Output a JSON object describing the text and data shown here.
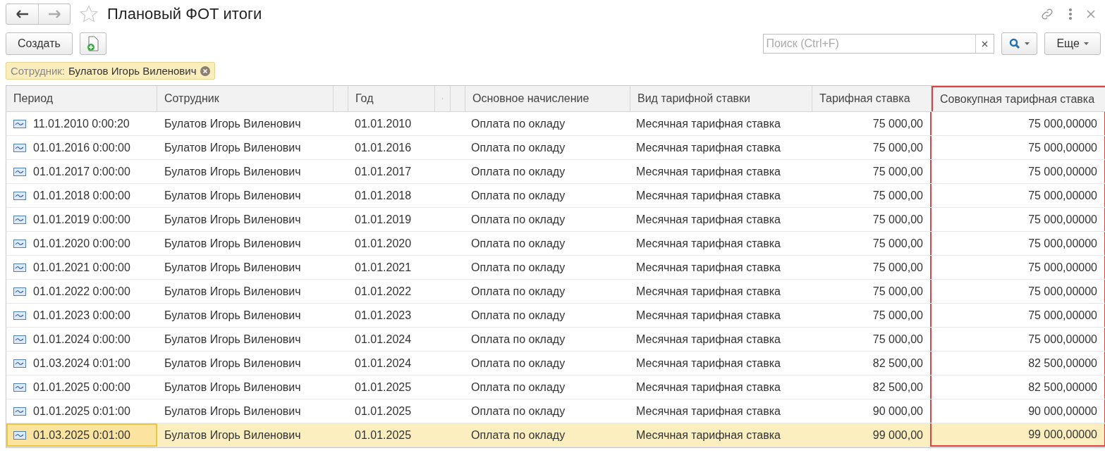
{
  "window": {
    "title": "Плановый ФОТ итоги",
    "favorite": false
  },
  "toolbar": {
    "create_label": "Создать",
    "search": {
      "placeholder": "Поиск (Ctrl+F)"
    },
    "more_label": "Еще"
  },
  "filter": {
    "label": "Сотрудник:",
    "value": "Булатов Игорь Виленович"
  },
  "table": {
    "columns": [
      {
        "label": "Период",
        "kind": "text",
        "highlighted": false
      },
      {
        "label": "Сотрудник",
        "kind": "text",
        "highlighted": false
      },
      {
        "kind": "spacer",
        "highlighted": false
      },
      {
        "label": "Год",
        "kind": "text",
        "highlighted": false
      },
      {
        "kind": "sort",
        "highlighted": false
      },
      {
        "kind": "spacer",
        "highlighted": false
      },
      {
        "label": "Основное начисление",
        "kind": "text",
        "highlighted": false
      },
      {
        "label": "Вид тарифной ставки",
        "kind": "text",
        "highlighted": false
      },
      {
        "label": "Тарифная ставка",
        "kind": "number",
        "highlighted": false
      },
      {
        "label": "Совокупная тарифная ставка",
        "kind": "number",
        "highlighted": true
      }
    ],
    "rows": [
      {
        "selected": false,
        "cells": [
          "11.01.2010 0:00:20",
          "Булатов Игорь Виленович",
          null,
          "01.01.2010",
          null,
          null,
          "Оплата по окладу",
          "Месячная тарифная ставка",
          "75 000,00",
          "75 000,00000"
        ]
      },
      {
        "selected": false,
        "cells": [
          "01.01.2016 0:00:00",
          "Булатов Игорь Виленович",
          null,
          "01.01.2016",
          null,
          null,
          "Оплата по окладу",
          "Месячная тарифная ставка",
          "75 000,00",
          "75 000,00000"
        ]
      },
      {
        "selected": false,
        "cells": [
          "01.01.2017 0:00:00",
          "Булатов Игорь Виленович",
          null,
          "01.01.2017",
          null,
          null,
          "Оплата по окладу",
          "Месячная тарифная ставка",
          "75 000,00",
          "75 000,00000"
        ]
      },
      {
        "selected": false,
        "cells": [
          "01.01.2018 0:00:00",
          "Булатов Игорь Виленович",
          null,
          "01.01.2018",
          null,
          null,
          "Оплата по окладу",
          "Месячная тарифная ставка",
          "75 000,00",
          "75 000,00000"
        ]
      },
      {
        "selected": false,
        "cells": [
          "01.01.2019 0:00:00",
          "Булатов Игорь Виленович",
          null,
          "01.01.2019",
          null,
          null,
          "Оплата по окладу",
          "Месячная тарифная ставка",
          "75 000,00",
          "75 000,00000"
        ]
      },
      {
        "selected": false,
        "cells": [
          "01.01.2020 0:00:00",
          "Булатов Игорь Виленович",
          null,
          "01.01.2020",
          null,
          null,
          "Оплата по окладу",
          "Месячная тарифная ставка",
          "75 000,00",
          "75 000,00000"
        ]
      },
      {
        "selected": false,
        "cells": [
          "01.01.2021 0:00:00",
          "Булатов Игорь Виленович",
          null,
          "01.01.2021",
          null,
          null,
          "Оплата по окладу",
          "Месячная тарифная ставка",
          "75 000,00",
          "75 000,00000"
        ]
      },
      {
        "selected": false,
        "cells": [
          "01.01.2022 0:00:00",
          "Булатов Игорь Виленович",
          null,
          "01.01.2022",
          null,
          null,
          "Оплата по окладу",
          "Месячная тарифная ставка",
          "75 000,00",
          "75 000,00000"
        ]
      },
      {
        "selected": false,
        "cells": [
          "01.01.2023 0:00:00",
          "Булатов Игорь Виленович",
          null,
          "01.01.2023",
          null,
          null,
          "Оплата по окладу",
          "Месячная тарифная ставка",
          "75 000,00",
          "75 000,00000"
        ]
      },
      {
        "selected": false,
        "cells": [
          "01.01.2024 0:00:00",
          "Булатов Игорь Виленович",
          null,
          "01.01.2024",
          null,
          null,
          "Оплата по окладу",
          "Месячная тарифная ставка",
          "75 000,00",
          "75 000,00000"
        ]
      },
      {
        "selected": false,
        "cells": [
          "01.03.2024 0:01:00",
          "Булатов Игорь Виленович",
          null,
          "01.01.2024",
          null,
          null,
          "Оплата по окладу",
          "Месячная тарифная ставка",
          "82 500,00",
          "82 500,00000"
        ]
      },
      {
        "selected": false,
        "cells": [
          "01.01.2025 0:00:00",
          "Булатов Игорь Виленович",
          null,
          "01.01.2025",
          null,
          null,
          "Оплата по окладу",
          "Месячная тарифная ставка",
          "82 500,00",
          "82 500,00000"
        ]
      },
      {
        "selected": false,
        "cells": [
          "01.01.2025 0:01:00",
          "Булатов Игорь Виленович",
          null,
          "01.01.2025",
          null,
          null,
          "Оплата по окладу",
          "Месячная тарифная ставка",
          "90 000,00",
          "90 000,00000"
        ]
      },
      {
        "selected": true,
        "cells": [
          "01.03.2025 0:01:00",
          "Булатов Игорь Виленович",
          null,
          "01.01.2025",
          null,
          null,
          "Оплата по окладу",
          "Месячная тарифная ставка",
          "99 000,00",
          "99 000,00000"
        ]
      }
    ]
  }
}
